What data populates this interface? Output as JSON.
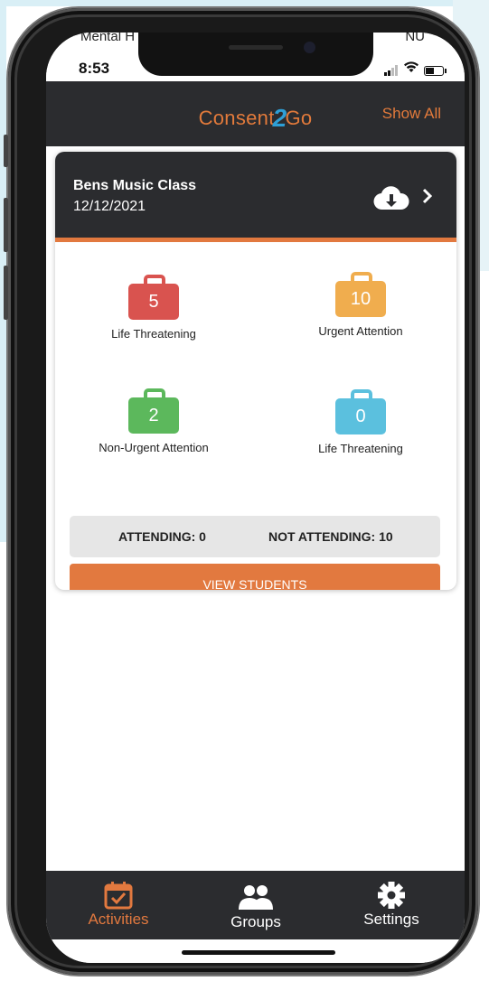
{
  "status_bar": {
    "carrier_left": "Mental H",
    "carrier_right": "NU",
    "time": "8:53"
  },
  "header": {
    "logo_part1": "Consent",
    "logo_part2": "2",
    "logo_part3": "Go",
    "show_all": "Show All"
  },
  "activity": {
    "name": "Bens Music Class",
    "date": "12/12/2021",
    "stats": [
      {
        "count": "5",
        "label": "Life Threatening",
        "color": "#d9534f"
      },
      {
        "count": "10",
        "label": "Urgent Attention",
        "color": "#f0ad4e"
      },
      {
        "count": "2",
        "label": "Non-Urgent Attention",
        "color": "#5cb85c"
      },
      {
        "count": "0",
        "label": "Life Threatening",
        "color": "#5bc0de"
      }
    ],
    "attending": "ATTENDING: 0",
    "not_attending": "NOT ATTENDING: 10",
    "view_students": "VIEW STUDENTS"
  },
  "tabs": [
    {
      "label": "Activities",
      "icon": "calendar-check-icon",
      "active": true
    },
    {
      "label": "Groups",
      "icon": "users-icon",
      "active": false
    },
    {
      "label": "Settings",
      "icon": "gear-icon",
      "active": false
    }
  ],
  "colors": {
    "accent": "#e2793f",
    "dark": "#2b2c2f",
    "logo_blue": "#2e9fd6"
  }
}
